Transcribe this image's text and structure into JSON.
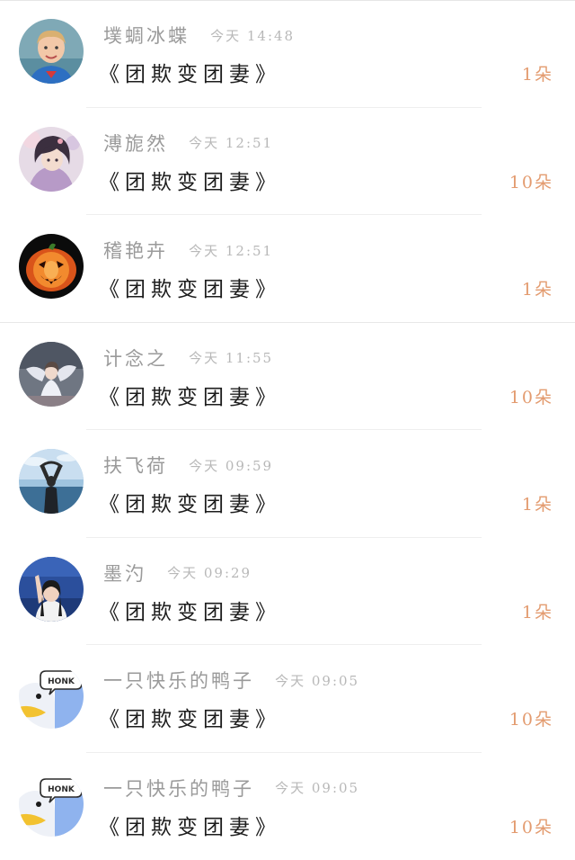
{
  "records": [
    {
      "name": "墣蜩冰蝶",
      "time": "今天 14:48",
      "message": "《团欺变团妻》",
      "amount": "1朵",
      "avatar_icon": "child-avatar-icon"
    },
    {
      "name": "溥旎然",
      "time": "今天 12:51",
      "message": "《团欺变团妻》",
      "amount": "10朵",
      "avatar_icon": "anime-girl-avatar-icon"
    },
    {
      "name": "稽艳卉",
      "time": "今天 12:51",
      "message": "《团欺变团妻》",
      "amount": "1朵",
      "avatar_icon": "pumpkin-avatar-icon"
    },
    {
      "name": "计念之",
      "time": "今天 11:55",
      "message": "《团欺变团妻》",
      "amount": "10朵",
      "avatar_icon": "dancer-avatar-icon"
    },
    {
      "name": "扶飞荷",
      "time": "今天 09:59",
      "message": "《团欺变团妻》",
      "amount": "1朵",
      "avatar_icon": "sea-girl-avatar-icon"
    },
    {
      "name": "墨汋",
      "time": "今天 09:29",
      "message": "《团欺变团妻》",
      "amount": "1朵",
      "avatar_icon": "waving-girl-avatar-icon"
    },
    {
      "name": "一只快乐的鸭子",
      "time": "今天 09:05",
      "message": "《团欺变团妻》",
      "amount": "10朵",
      "avatar_icon": "honk-duck-avatar-icon",
      "avatar_text": "HONK"
    },
    {
      "name": "一只快乐的鸭子",
      "time": "今天 09:05",
      "message": "《团欺变团妻》",
      "amount": "10朵",
      "avatar_icon": "honk-duck-avatar-icon",
      "avatar_text": "HONK"
    }
  ],
  "colors": {
    "amount": "#e39b6f",
    "name": "#9a9a9a",
    "time": "#b8b8b8",
    "message": "#1d1d1d"
  }
}
